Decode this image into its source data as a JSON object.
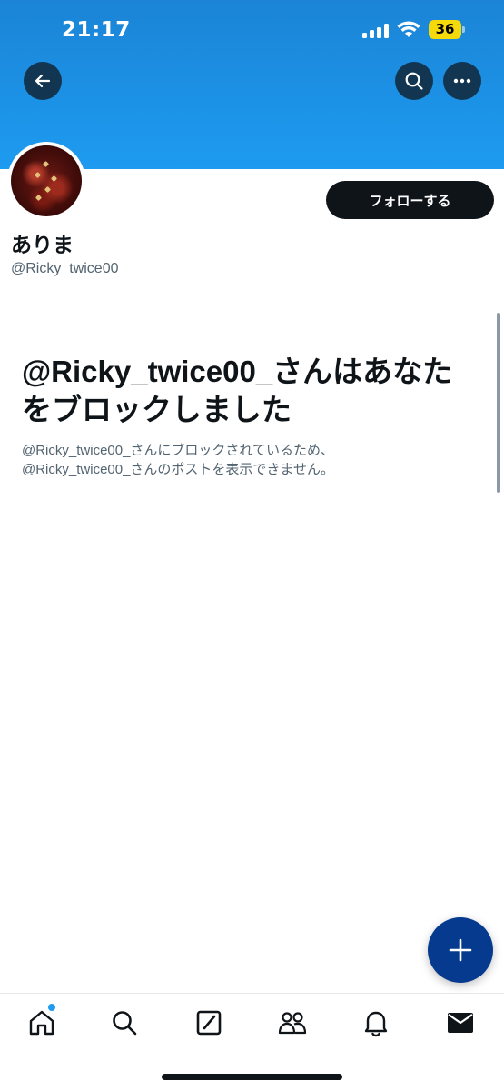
{
  "status_bar": {
    "time": "21:17",
    "battery": "36",
    "battery_color": "#f5d90a"
  },
  "header": {
    "banner_color": "#1d9bf0",
    "back_icon": "arrow-left-icon",
    "search_icon": "search-icon",
    "more_icon": "more-horizontal-icon"
  },
  "profile": {
    "display_name": "ありま",
    "handle": "@Ricky_twice00_",
    "follow_label": "フォローする"
  },
  "blocked": {
    "title": "@Ricky_twice00_さんはあなたをブロックしました",
    "description": "@Ricky_twice00_さんにブロックされているため、\n@Ricky_twice00_さんのポストを表示できません。"
  },
  "fab": {
    "icon": "plus-icon",
    "color": "#053a8f"
  },
  "tab_bar": {
    "items": [
      "home-icon",
      "search-icon",
      "grok-icon",
      "communities-icon",
      "notifications-icon",
      "messages-icon"
    ],
    "notification_dot_color": "#1d9bf0"
  }
}
